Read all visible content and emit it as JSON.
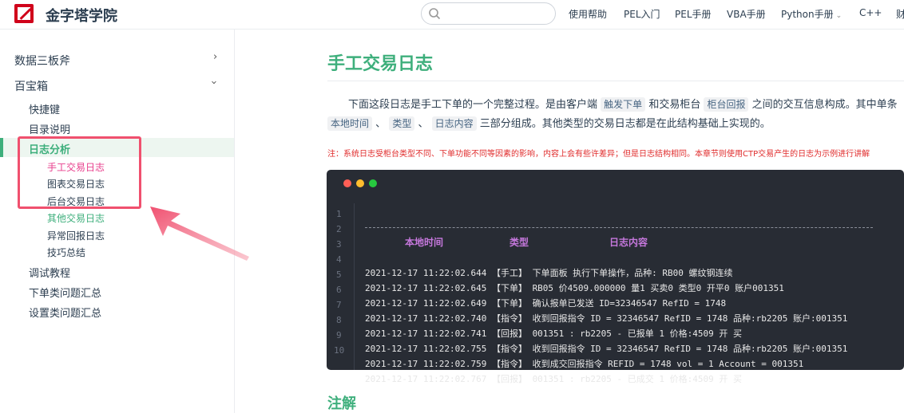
{
  "header": {
    "site_title": "金字塔学院",
    "search_placeholder": "",
    "nav": [
      "使用帮助",
      "PEL入门",
      "PEL手册",
      "VBA手册",
      "Python手册",
      "C++",
      "财"
    ]
  },
  "sidebar": {
    "groups": [
      {
        "label": "数据三板斧",
        "expanded": false
      },
      {
        "label": "百宝箱",
        "expanded": true
      }
    ],
    "items": [
      "快捷键",
      "目录说明",
      "日志分析",
      "调试教程",
      "下单类问题汇总",
      "设置类问题汇总"
    ],
    "log_sub_items": [
      "手工交易日志",
      "图表交易日志",
      "后台交易日志",
      "其他交易日志",
      "异常回报日志",
      "技巧总结"
    ]
  },
  "content": {
    "title": "手工交易日志",
    "para1_a": "下面这段日志是手工下单的一个完整过程。是由客户端",
    "para1_code1": "触发下单",
    "para1_b": "和交易柜台",
    "para1_code2": "柜台回报",
    "para1_c": "之间的交互信息构成。其中单条",
    "para2_code1": "本地时间",
    "para2_sep": "、",
    "para2_code2": "类型",
    "para2_code3": "日志内容",
    "para2_rest": "三部分组成。其他类型的交易日志都是在此结构基础上实现的。",
    "note": "注：系统日志受柜台类型不同、下单功能不同等因素的影响，内容上会有些许差异；但是日志结构相同。本章节则使用CTP交易产生的日志为示例进行讲解",
    "code": {
      "headers": [
        "本地时间",
        "类型",
        "日志内容"
      ],
      "line_numbers": [
        "1",
        "2",
        "3",
        "4",
        "5",
        "6",
        "7",
        "8",
        "9",
        "10"
      ],
      "lines": [
        "2021-12-17 11:22:02.644    【手工】 下单面板 执行下单操作，品种: RB00 螺纹钢连续",
        "2021-12-17 11:22:02.645    【下单】 RB05 价4509.000000 量1 买卖0 类型0 开平0 账户001351",
        "2021-12-17 11:22:02.649    【下单】 确认报单已发送 ID=32346547 RefID = 1748",
        "2021-12-17 11:22:02.740    【指令】 收到回报指令 ID = 32346547 RefID = 1748 品种:rb2205 账户:001351",
        "2021-12-17 11:22:02.741    【回报】 001351 : rb2205 - 已报单 1 价格:4509 开 买",
        "2021-12-17 11:22:02.755    【指令】 收到回报指令 ID = 32346547 RefID = 1748 品种:rb2205 账户:001351",
        "2021-12-17 11:22:02.759    【指令】 收到成交回报指令 REFID = 1748 vol = 1 Account = 001351",
        "2021-12-17 11:22:02.767    【回报】 001351 : rb2205 - 已成交 1 价格:4509 开 买"
      ]
    },
    "section2_title": "注解"
  },
  "colors": {
    "accent": "#3eaf7c",
    "highlight_box": "#f0506e",
    "active_sub": "#e83e8c"
  }
}
